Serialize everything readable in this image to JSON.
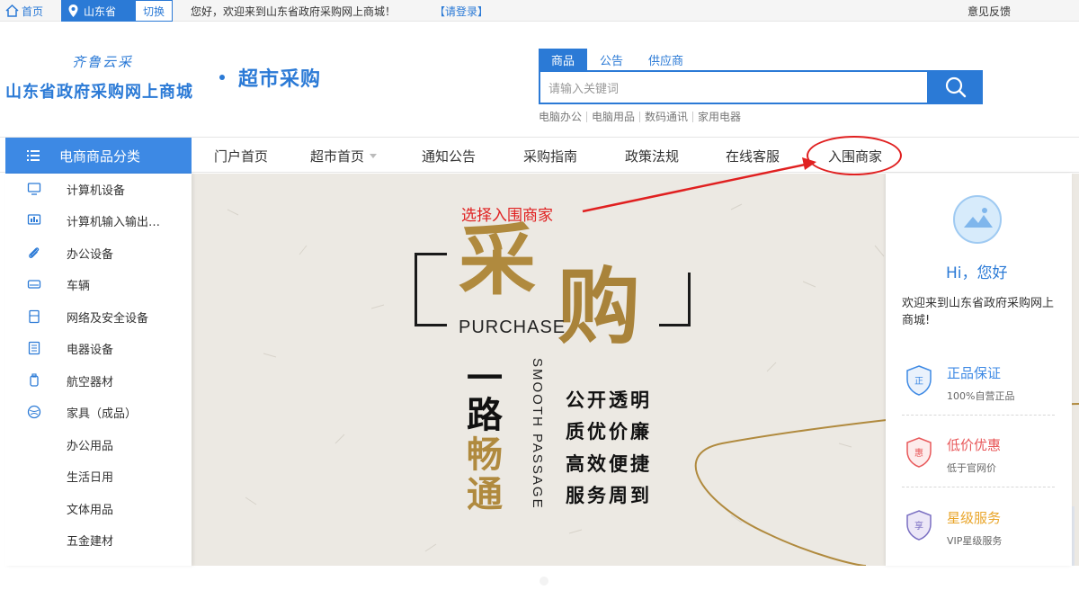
{
  "topbar": {
    "home": "首页",
    "region": "山东省",
    "switch": "切换",
    "welcome": "您好，欢迎来到山东省政府采购网上商城！",
    "login": "【请登录】",
    "feedback": "意见反馈"
  },
  "header": {
    "slogan": "齐鲁云采",
    "site_name": "山东省政府采购网上商城",
    "sub_title": "超市采购",
    "search": {
      "tabs": [
        "商品",
        "公告",
        "供应商"
      ],
      "placeholder": "请输入关键词"
    },
    "hot_words": [
      "电脑办公",
      "电脑用品",
      "数码通讯",
      "家用电器"
    ]
  },
  "nav": {
    "category_title": "电商商品分类",
    "items": [
      "门户首页",
      "超市首页",
      "通知公告",
      "采购指南",
      "政策法规",
      "在线客服",
      "入围商家"
    ]
  },
  "categories": [
    "计算机设备",
    "计算机输入输出…",
    "办公设备",
    "车辆",
    "网络及安全设备",
    "电器设备",
    "航空器材",
    "家具（成品）",
    "办公用品",
    "生活日用",
    "文体用品",
    "五金建材"
  ],
  "banner": {
    "annotation": "选择入围商家",
    "char_cai": "采",
    "char_gou": "购",
    "purchase": "PURCHASE",
    "vert_chars": [
      "一",
      "路",
      "畅",
      "通"
    ],
    "smooth_passage": "SMOOTH PASSAGE",
    "slogans": [
      "公开透明",
      "质优价廉",
      "高效便捷",
      "服务周到"
    ]
  },
  "welcome_card": {
    "hi": "Hi，您好",
    "text": "欢迎来到山东省政府采购网上商城!",
    "features": [
      {
        "title": "正品保证",
        "sub": "100%自营正品",
        "badge": "正",
        "color": "#3d89e4"
      },
      {
        "title": "低价优惠",
        "sub": "低于官网价",
        "badge": "惠",
        "color": "#e8585a"
      },
      {
        "title": "星级服务",
        "sub": "VIP星级服务",
        "badge": "享",
        "color": "#e9a52a"
      }
    ]
  },
  "colors": {
    "brand": "#2b7ad6",
    "category_header": "#3d89e4",
    "annotation": "#e02020",
    "gold": "#b08a3e"
  }
}
